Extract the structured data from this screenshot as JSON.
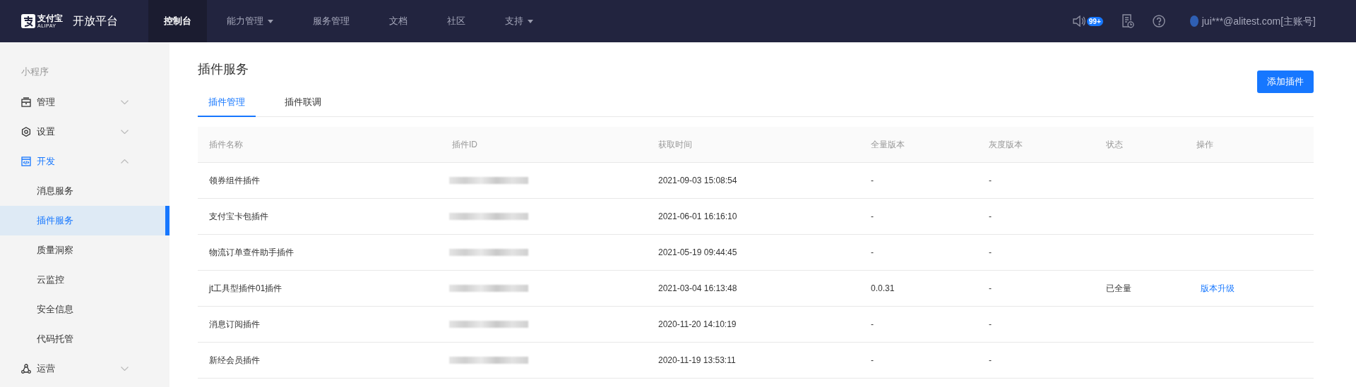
{
  "header": {
    "logo_text": "支付宝",
    "logo_sub": "ALIPAY",
    "platform": "开放平台",
    "nav": [
      {
        "label": "控制台",
        "selected": true,
        "dropdown": false
      },
      {
        "label": "能力管理",
        "selected": false,
        "dropdown": true
      },
      {
        "label": "服务管理",
        "selected": false,
        "dropdown": false
      },
      {
        "label": "文档",
        "selected": false,
        "dropdown": false
      },
      {
        "label": "社区",
        "selected": false,
        "dropdown": false
      },
      {
        "label": "支持",
        "selected": false,
        "dropdown": true
      }
    ],
    "notification_badge": "99+",
    "user": "jui***@alitest.com[主账号]"
  },
  "sidebar": {
    "section": "小程序",
    "items": [
      {
        "label": "管理",
        "expanded": false
      },
      {
        "label": "设置",
        "expanded": false
      },
      {
        "label": "开发",
        "expanded": true,
        "children": [
          {
            "label": "消息服务",
            "selected": false
          },
          {
            "label": "插件服务",
            "selected": true
          },
          {
            "label": "质量洞察",
            "selected": false
          },
          {
            "label": "云监控",
            "selected": false
          },
          {
            "label": "安全信息",
            "selected": false
          },
          {
            "label": "代码托管",
            "selected": false
          }
        ]
      },
      {
        "label": "运营",
        "expanded": false
      }
    ]
  },
  "page": {
    "title": "插件服务",
    "add_button": "添加插件",
    "tabs": [
      {
        "label": "插件管理",
        "selected": true
      },
      {
        "label": "插件联调",
        "selected": false
      }
    ],
    "table": {
      "columns": [
        "插件名称",
        "插件ID",
        "获取时间",
        "全量版本",
        "灰度版本",
        "状态",
        "操作"
      ],
      "rows": [
        {
          "name": "领券组件插件",
          "time": "2021-09-03 15:08:54",
          "full_version": "-",
          "gray_version": "-"
        },
        {
          "name": "支付宝卡包插件",
          "time": "2021-06-01 16:16:10",
          "full_version": "-",
          "gray_version": "-"
        },
        {
          "name": "物流订单查件助手插件",
          "time": "2021-05-19 09:44:45",
          "full_version": "-",
          "gray_version": "-"
        },
        {
          "name": "jt工具型插件01插件",
          "time": "2021-03-04 16:13:48",
          "full_version": "0.0.31",
          "gray_version": "-",
          "status": "已全量",
          "action": "版本升级"
        },
        {
          "name": "消息订阅插件",
          "time": "2020-11-20 14:10:19",
          "full_version": "-",
          "gray_version": "-"
        },
        {
          "name": "新经会员插件",
          "time": "2020-11-19 13:53:11",
          "full_version": "-",
          "gray_version": "-"
        }
      ]
    }
  }
}
